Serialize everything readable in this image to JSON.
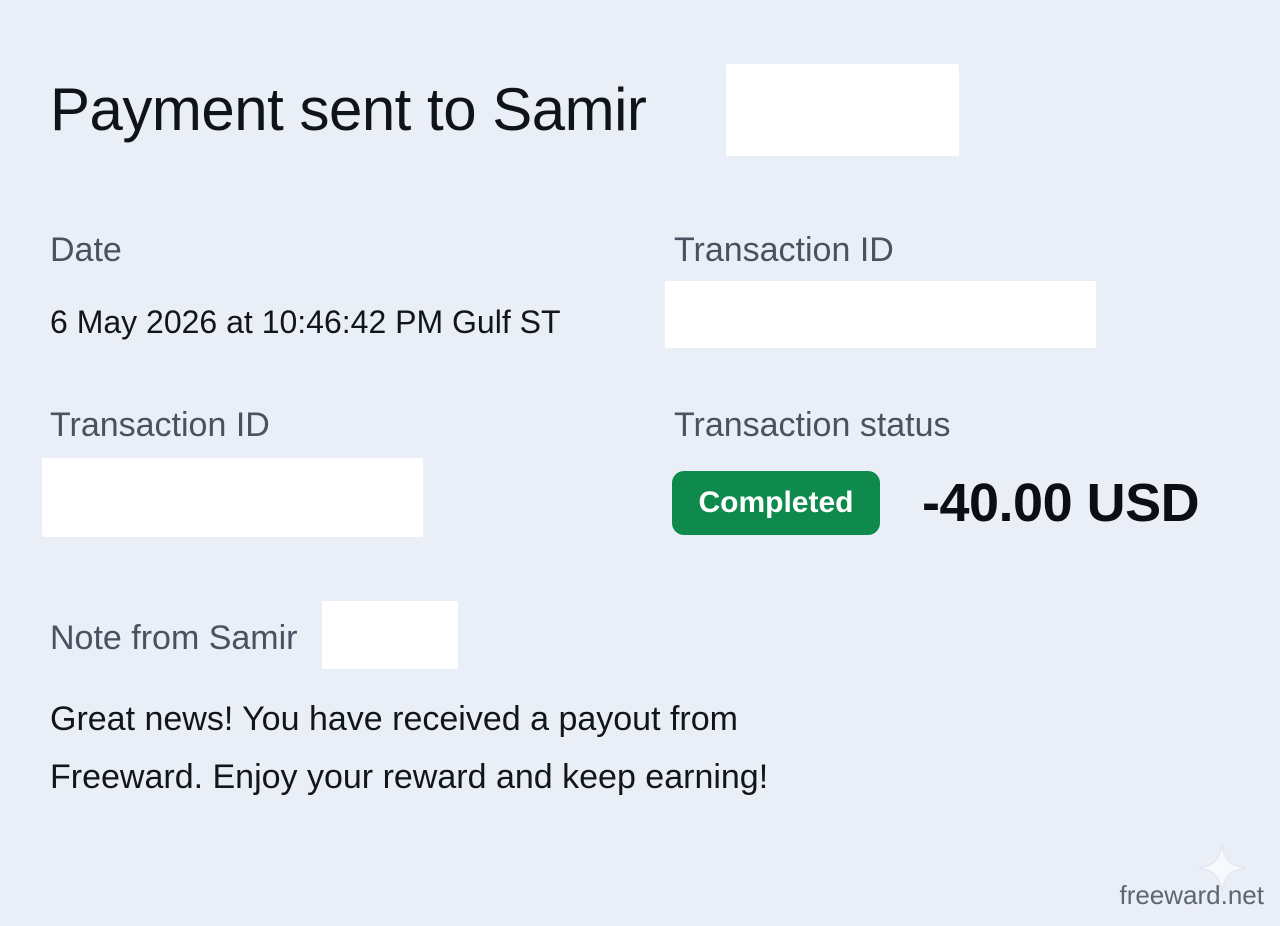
{
  "header": {
    "title": "Payment sent to Samir"
  },
  "details": {
    "date_label": "Date",
    "date_value": "6 May 2026 at 10:46:42 PM Gulf ST",
    "transaction_id_label_right": "Transaction ID",
    "transaction_id_label_left": "Transaction ID",
    "status_label": "Transaction status",
    "status_value": "Completed",
    "amount": "-40.00 USD"
  },
  "note": {
    "label": "Note from Samir",
    "text": "Great news! You have received a payout from Freeward. Enjoy your reward and keep earning!"
  },
  "watermark": {
    "text": "freeward.net",
    "icon": "sparkle-icon"
  },
  "colors": {
    "background": "#eaeef6",
    "status_completed": "#0e8a4c",
    "redaction": "#ffffff"
  }
}
